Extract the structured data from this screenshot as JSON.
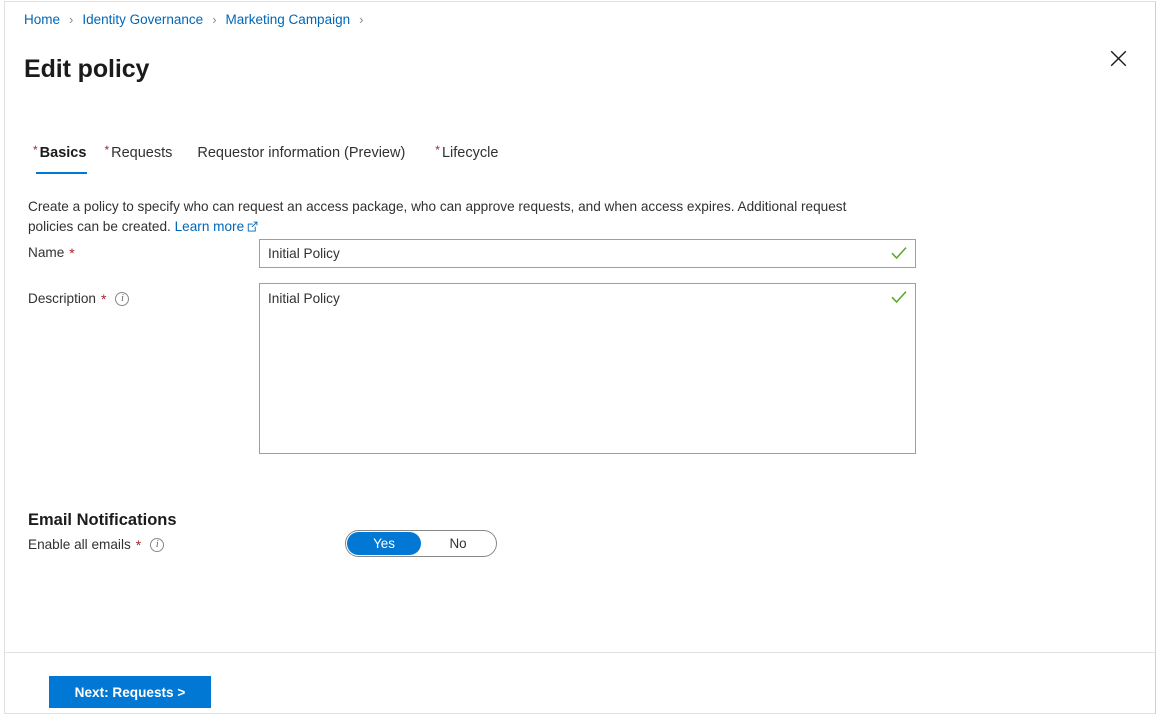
{
  "breadcrumb": {
    "separator": "›",
    "items": [
      {
        "label": "Home"
      },
      {
        "label": "Identity Governance"
      },
      {
        "label": "Marketing Campaign"
      }
    ]
  },
  "header": {
    "title": "Edit policy",
    "close_icon": "close-icon"
  },
  "tabs": [
    {
      "label": "Basics",
      "required": true,
      "active": true
    },
    {
      "label": "Requests",
      "required": true,
      "active": false
    },
    {
      "label": "Requestor information (Preview)",
      "required": false,
      "active": false
    },
    {
      "label": "Lifecycle",
      "required": true,
      "active": false
    }
  ],
  "intro": {
    "text": "Create a policy to specify who can request an access package, who can approve requests, and when access expires. Additional request policies can be created. ",
    "link_label": "Learn more",
    "link_icon": "external-link-icon"
  },
  "form": {
    "name": {
      "label": "Name",
      "required_mark": "*",
      "value": "Initial Policy",
      "placeholder": "",
      "validation_icon": "checkmark-icon"
    },
    "description": {
      "label": "Description",
      "required_mark": "*",
      "info_icon": "info-icon",
      "info_glyph": "i",
      "value": "Initial Policy",
      "placeholder": "",
      "validation_icon": "checkmark-icon"
    }
  },
  "email_notifications": {
    "section_title": "Email Notifications",
    "enable_all": {
      "label": "Enable all emails",
      "required_mark": "*",
      "info_icon": "info-icon",
      "info_glyph": "i",
      "options": [
        {
          "label": "Yes",
          "selected": true
        },
        {
          "label": "No",
          "selected": false
        }
      ]
    }
  },
  "footer": {
    "next_button_label": "Next: Requests >"
  },
  "colors": {
    "accent": "#0078d4",
    "link": "#0067b8",
    "required_star": "#a4262c",
    "valid_check": "#5aa525",
    "text": "#323130"
  }
}
